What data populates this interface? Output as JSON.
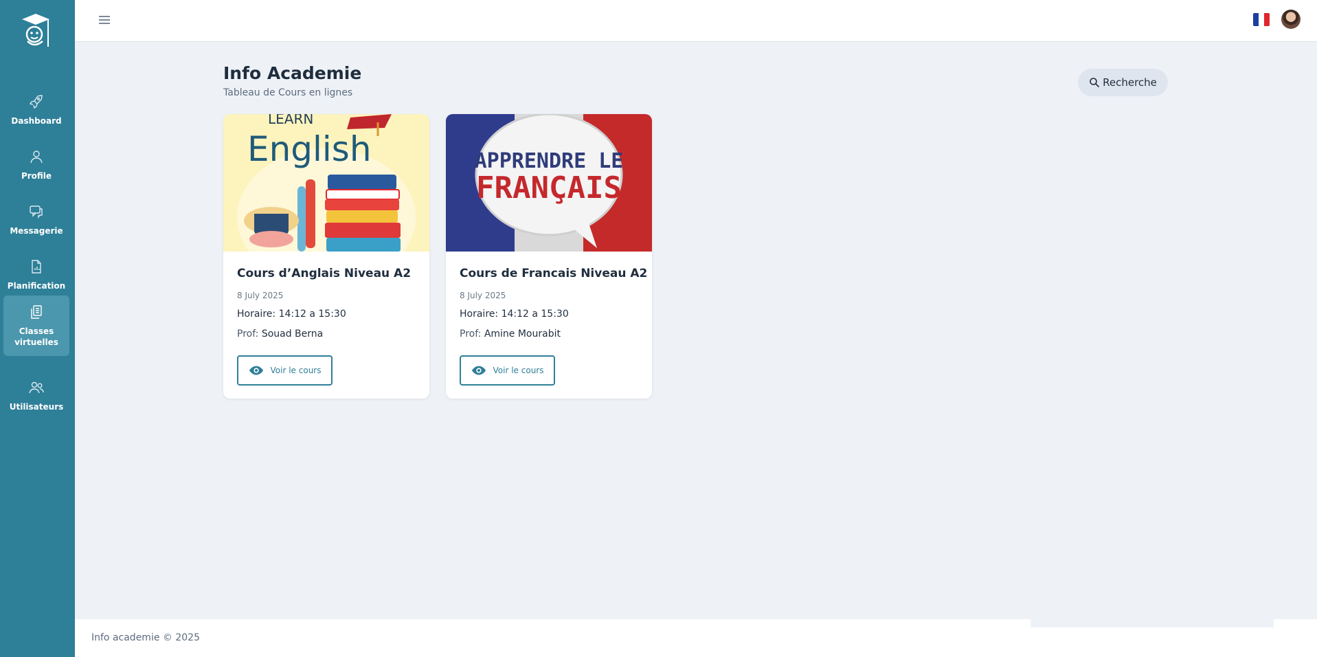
{
  "sidebar": {
    "items": [
      {
        "label": "Dashboard",
        "icon": "rocket-icon"
      },
      {
        "label": "Profile",
        "icon": "user-icon"
      },
      {
        "label": "Messagerie",
        "icon": "chat-icon"
      },
      {
        "label": "Planification",
        "icon": "document-chart-icon"
      },
      {
        "label": "Classes virtuelles",
        "icon": "copy-document-icon",
        "active": true
      },
      {
        "label": "Utilisateurs",
        "icon": "users-icon"
      }
    ]
  },
  "header": {
    "title": "Info Academie",
    "subtitle": "Tableau de Cours en lignes",
    "search_label": "Recherche"
  },
  "courses": [
    {
      "image_text_small": "LEARN",
      "image_text_big": "English",
      "title": "Cours d’Anglais Niveau A2",
      "date": "8 July 2025",
      "hours_label": "Horaire:",
      "hours": "14:12 a 15:30",
      "prof_label": "Prof:",
      "prof": "Souad Berna",
      "button_label": "Voir le cours"
    },
    {
      "image_text_small": "APPRENDRE LE",
      "image_text_big": "FRANÇAIS",
      "title": "Cours de Francais Niveau A2",
      "date": "8 July 2025",
      "hours_label": "Horaire:",
      "hours": "14:12 a 15:30",
      "prof_label": "Prof:",
      "prof": "Amine Mourabit",
      "button_label": "Voir le cours"
    }
  ],
  "footer": {
    "text": "Info academie © 2025"
  },
  "colors": {
    "sidebar": "#2e7f98",
    "sidebar_active": "#4b97ad",
    "background": "#eef2f7",
    "accent": "#2e7f98"
  }
}
